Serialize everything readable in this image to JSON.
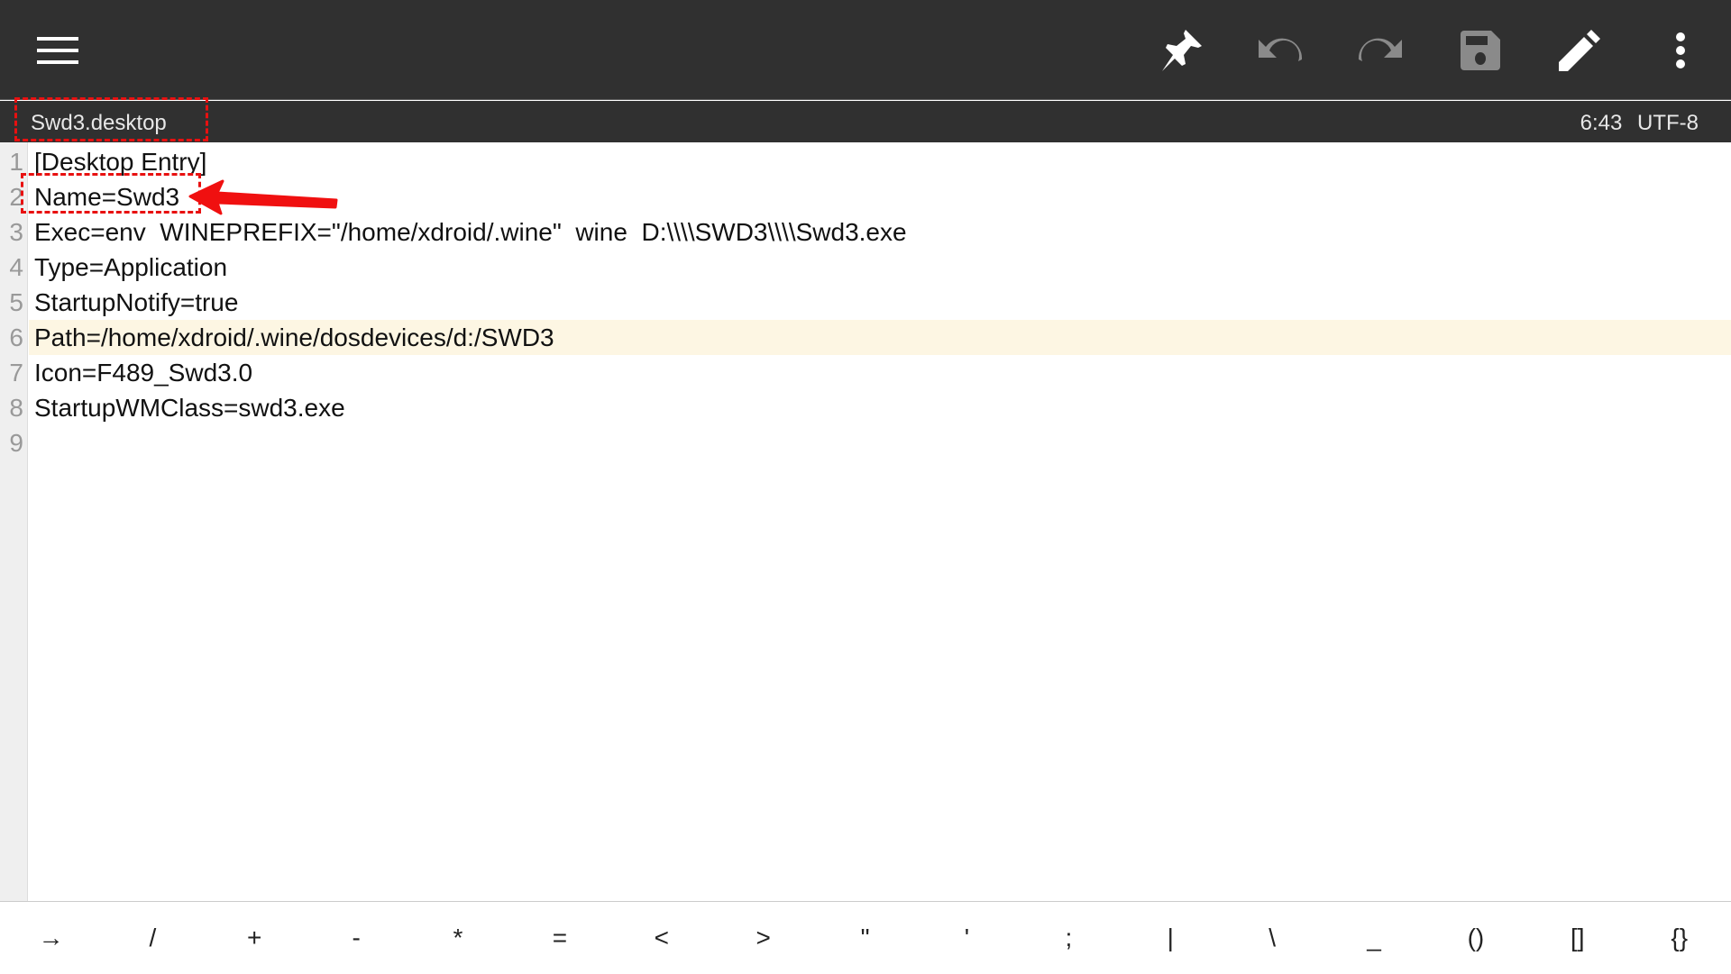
{
  "toolbar": {
    "icons": [
      "menu-icon",
      "pin-icon",
      "undo-icon",
      "redo-icon",
      "save-icon",
      "edit-icon",
      "more-icon"
    ]
  },
  "filebar": {
    "filename": "Swd3.desktop",
    "cursor": "6:43",
    "encoding": "UTF-8"
  },
  "editor": {
    "lines": [
      {
        "n": "1",
        "text": "[Desktop Entry]"
      },
      {
        "n": "2",
        "text": "Name=Swd3"
      },
      {
        "n": "3",
        "text": "Exec=env  WINEPREFIX=\"/home/xdroid/.wine\"  wine  D:\\\\\\\\SWD3\\\\\\\\Swd3.exe"
      },
      {
        "n": "4",
        "text": "Type=Application"
      },
      {
        "n": "5",
        "text": "StartupNotify=true"
      },
      {
        "n": "6",
        "text": "Path=/home/xdroid/.wine/dosdevices/d:/SWD3"
      },
      {
        "n": "7",
        "text": "Icon=F489_Swd3.0"
      },
      {
        "n": "8",
        "text": "StartupWMClass=swd3.exe"
      },
      {
        "n": "9",
        "text": ""
      }
    ],
    "highlighted_line": 6
  },
  "keys": [
    "→",
    "/",
    "+",
    "-",
    "*",
    "=",
    "<",
    ">",
    "\"",
    "'",
    ";",
    "|",
    "\\",
    "_",
    "()",
    "[]",
    "{}"
  ],
  "colors": {
    "toolbar": "#303030",
    "highlight": "#fdf6e3",
    "annotation": "#e81010"
  }
}
